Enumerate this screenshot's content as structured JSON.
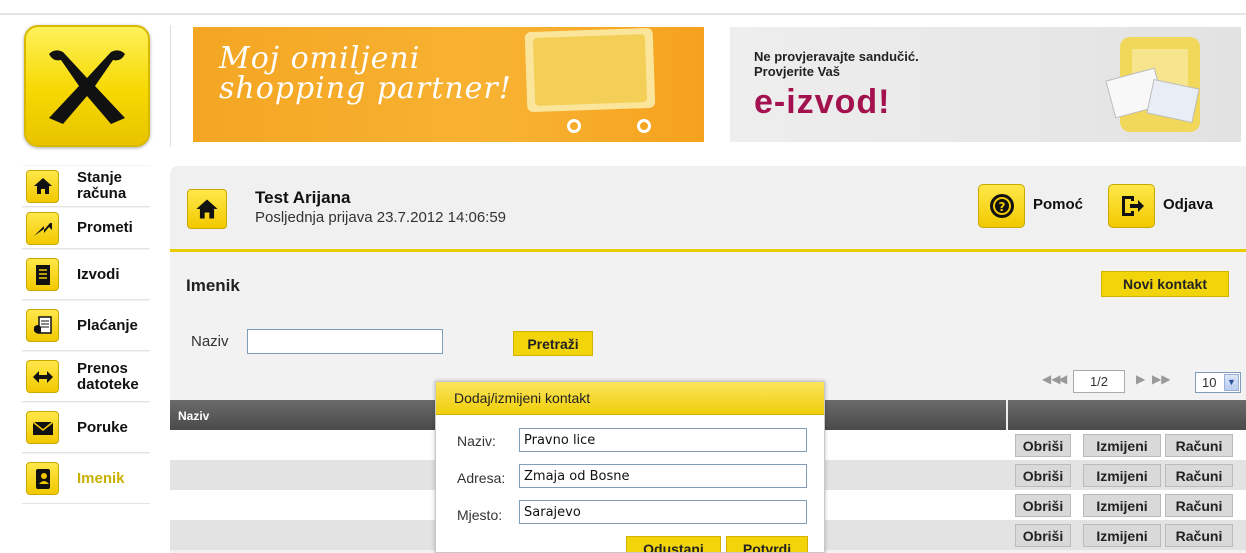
{
  "banners": {
    "shopping": {
      "line1": "Moj omiljeni",
      "line2": "shopping partner!"
    },
    "eizvod": {
      "line1": "Ne provjeravajte sandučić.",
      "line2": "Provjerite Vaš",
      "headline": "e-izvod!"
    }
  },
  "nav": {
    "items": [
      {
        "label_1": "Stanje",
        "label_2": "računa",
        "icon": "home-icon"
      },
      {
        "label": "Prometi",
        "icon": "trend-up-icon"
      },
      {
        "label": "Izvodi",
        "icon": "document-icon"
      },
      {
        "label": "Plaćanje",
        "icon": "payment-icon"
      },
      {
        "label_1": "Prenos",
        "label_2": "datoteke",
        "icon": "transfer-arrows-icon"
      },
      {
        "label": "Poruke",
        "icon": "envelope-icon"
      },
      {
        "label": "Imenik",
        "icon": "contacts-book-icon",
        "active": true
      }
    ]
  },
  "header": {
    "user_name": "Test Arijana",
    "last_login": "Posljednja prijava 23.7.2012 14:06:59",
    "help_label": "Pomoć",
    "logout_label": "Odjava"
  },
  "main": {
    "title": "Imenik",
    "new_contact_label": "Novi kontakt",
    "search": {
      "label": "Naziv",
      "value": "",
      "button": "Pretraži"
    },
    "pager": {
      "page": "1/2",
      "page_size": "10"
    },
    "table": {
      "columns": [
        "Naziv",
        ""
      ],
      "row_actions": [
        "Obriši",
        "Izmijeni",
        "Računi"
      ],
      "rows": [
        {
          "naziv": ""
        },
        {
          "naziv": ""
        },
        {
          "naziv": ""
        },
        {
          "naziv": ""
        }
      ]
    }
  },
  "modal": {
    "title": "Dodaj/izmijeni kontakt",
    "fields": [
      {
        "label": "Naziv:",
        "value": "Pravno lice"
      },
      {
        "label": "Adresa:",
        "value": "Zmaja od Bosne"
      },
      {
        "label": "Mjesto:",
        "value": "Sarajevo"
      }
    ],
    "cancel_label": "Odustani",
    "confirm_label": "Potvrdi"
  },
  "colors": {
    "brand_yellow": "#f2d40a",
    "active_nav": "#c9b100",
    "eizvod_accent": "#a3124f",
    "banner_orange": "#f6a623"
  }
}
